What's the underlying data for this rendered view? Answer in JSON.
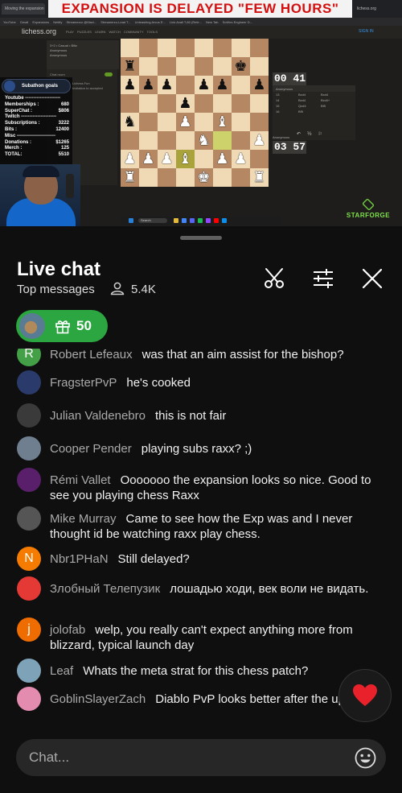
{
  "stream": {
    "banner": "EXPANSION IS DELAYED \"FEW HOURS\"",
    "browser_tabs": [
      "Moving the expansion - Play L...",
      "lichess.org"
    ],
    "bookmarks": [
      "YouTube",
      "Gmail",
      "Expansions",
      "Netlify",
      "Streamerzo @Maxi...",
      "Streamerzo-Lead T...",
      "Unleashing Arcus E...",
      "Link Avail T-80 (Rele...",
      "New Tab",
      "SoWes Engineer D..."
    ],
    "site": {
      "logo": "lichess.org",
      "nav": "PLAY PUZZLES LEARN WATCH COMMUNITY TOOLS",
      "sign_in": "SIGN IN"
    },
    "game_info": [
      "3+2 • Casual • Blitz",
      "Anonymous",
      "Anonymous"
    ],
    "game_chat_label": "Chat room",
    "game_chat_lines": [
      "Lichess Fun",
      "Invitation to accepted"
    ],
    "goals": {
      "title": "Subathon goals",
      "rows": [
        {
          "label": "Youtube ----------------------",
          "value": ""
        },
        {
          "label": "Memberships :",
          "value": "680"
        },
        {
          "label": "SuperChat :",
          "value": "$806"
        },
        {
          "label": "Twitch ----------------------",
          "value": ""
        },
        {
          "label": "Subscriptions :",
          "value": "3222"
        },
        {
          "label": "Bits :",
          "value": "12400"
        },
        {
          "label": "Misc ------------------------",
          "value": ""
        },
        {
          "label": "Donations :",
          "value": "$1265"
        },
        {
          "label": "Merch :",
          "value": "125"
        },
        {
          "label": "TOTAL:",
          "value": "5510"
        }
      ]
    },
    "board": [
      [
        "",
        "",
        "",
        "",
        "",
        "",
        "",
        ""
      ],
      [
        "bR",
        "",
        "",
        "",
        "",
        "",
        "bK",
        ""
      ],
      [
        "bP",
        "bP",
        "bP",
        "",
        "bP",
        "bP",
        "",
        "bP"
      ],
      [
        "",
        "",
        "",
        "bP",
        "",
        "",
        "",
        ""
      ],
      [
        "bN",
        "",
        "",
        "wP",
        "",
        "wB",
        "",
        ""
      ],
      [
        "",
        "",
        "",
        "",
        "wN",
        "",
        "",
        "wP"
      ],
      [
        "wP",
        "wP",
        "wP",
        "wB",
        "",
        "wP",
        "wP",
        ""
      ],
      [
        "wR",
        "",
        "",
        "",
        "wK",
        "",
        "",
        "wR"
      ]
    ],
    "board_highlights": [
      [
        6,
        3
      ],
      [
        5,
        5
      ]
    ],
    "clock_top": "00 41",
    "clock_bottom": "03 57",
    "player_top": "Anonymous",
    "player_bottom": "Anonymous",
    "moves": [
      [
        "13",
        "Bxd4",
        "Bxd4"
      ],
      [
        "14",
        "Bxd4",
        "Bxc6+"
      ],
      [
        "15",
        "Qxd4",
        "Bf5"
      ],
      [
        "16",
        "Bf5",
        ""
      ]
    ],
    "move_controls": "↶ ½ ⚐",
    "taskbar_search": "Search",
    "starforge": "STARFORGE"
  },
  "chat": {
    "title": "Live chat",
    "filter": "Top messages",
    "viewer_count": "5.4K",
    "gift_count": "50",
    "input_placeholder": "Chat...",
    "messages": [
      {
        "author": "Robert Lefeaux",
        "text": "was that an aim assist for the bishop?",
        "avatar": "R",
        "avatar_color": "#43a047"
      },
      {
        "author": "FragsterPvP",
        "text": "he's cooked",
        "avatar": "",
        "avatar_color": "#2a3a6a"
      },
      {
        "author": "Julian Valdenebro",
        "text": "this is not fair",
        "avatar": "",
        "avatar_color": "#3a3a3a"
      },
      {
        "author": "Cooper Pender",
        "text": "playing subs raxx? ;)",
        "avatar": "",
        "avatar_color": "#6f7f8f"
      },
      {
        "author": "Rémi Vallet",
        "text": "Ooooooo the expansion looks so nice. Good to see you playing chess Raxx",
        "avatar": "",
        "avatar_color": "#5a1f6a"
      },
      {
        "author": "Mike Murray",
        "text": "Came to see how the Exp was and I never thought id be watching raxx play chess.",
        "avatar": "",
        "avatar_color": "#555555"
      },
      {
        "author": "Nbr1PHaN",
        "text": "Still delayed?",
        "avatar": "N",
        "avatar_color": "#f57c00"
      },
      {
        "author": "Злобный Телепузик",
        "text": "лошадью ходи, век воли не видать.",
        "avatar": "",
        "avatar_color": "#e53935"
      },
      {
        "author": "jolofab",
        "text": "welp, you really can't expect anything more from blizzard, typical launch day",
        "avatar": "j",
        "avatar_color": "#ef6c00"
      },
      {
        "author": "Leaf",
        "text": "Whats the meta strat for this chess patch?",
        "avatar": "",
        "avatar_color": "#7ea3b8"
      },
      {
        "author": "GoblinSlayerZach",
        "text": "Diablo PvP looks better after the update~",
        "avatar": "",
        "avatar_color": "#e48bb0"
      }
    ]
  },
  "icons": {
    "viewers": "person-outline-icon",
    "scissors": "scissors-icon",
    "tune": "tune-sliders-icon",
    "close": "close-icon",
    "gift": "gift-icon",
    "heart": "heart-icon",
    "emoji": "emoji-icon"
  }
}
